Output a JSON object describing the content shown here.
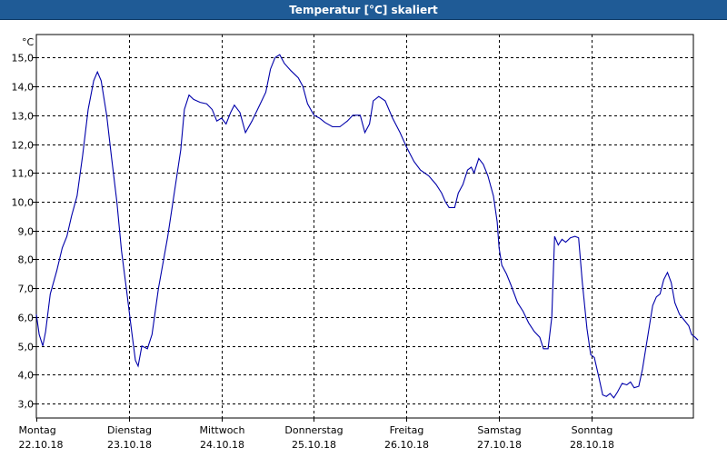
{
  "window": {
    "title": "Temperatur [°C] skaliert"
  },
  "chart_data": {
    "type": "line",
    "title": "Temperatur [°C] skaliert",
    "y_unit": "°C",
    "ylim": [
      2.5,
      15.8
    ],
    "yticks": [
      3.0,
      4.0,
      5.0,
      6.0,
      7.0,
      8.0,
      9.0,
      10.0,
      11.0,
      12.0,
      13.0,
      14.0,
      15.0
    ],
    "ytick_labels": [
      "3,0",
      "4,0",
      "5,0",
      "6,0",
      "7,0",
      "8,0",
      "9,0",
      "10,0",
      "11,0",
      "12,0",
      "13,0",
      "14,0",
      "15,0"
    ],
    "x_unit": "day",
    "xlim": [
      0,
      7.1
    ],
    "xticks": [
      {
        "x": 0,
        "day": "Montag",
        "date": "22.10.18"
      },
      {
        "x": 1,
        "day": "Dienstag",
        "date": "23.10.18"
      },
      {
        "x": 2,
        "day": "Mittwoch",
        "date": "24.10.18"
      },
      {
        "x": 3,
        "day": "Donnerstag",
        "date": "25.10.18"
      },
      {
        "x": 4,
        "day": "Freitag",
        "date": "26.10.18"
      },
      {
        "x": 5,
        "day": "Samstag",
        "date": "27.10.18"
      },
      {
        "x": 6,
        "day": "Sonntag",
        "date": "28.10.18"
      }
    ],
    "grid": true,
    "line_color": "#0000aa",
    "series": [
      {
        "points": [
          [
            0.0,
            6.1
          ],
          [
            0.03,
            5.4
          ],
          [
            0.07,
            5.0
          ],
          [
            0.1,
            5.5
          ],
          [
            0.15,
            6.8
          ],
          [
            0.22,
            7.6
          ],
          [
            0.28,
            8.4
          ],
          [
            0.33,
            8.8
          ],
          [
            0.38,
            9.5
          ],
          [
            0.44,
            10.2
          ],
          [
            0.5,
            11.6
          ],
          [
            0.56,
            13.2
          ],
          [
            0.62,
            14.2
          ],
          [
            0.66,
            14.5
          ],
          [
            0.7,
            14.2
          ],
          [
            0.76,
            13.0
          ],
          [
            0.81,
            11.6
          ],
          [
            0.87,
            10.0
          ],
          [
            0.92,
            8.3
          ],
          [
            0.98,
            6.8
          ],
          [
            1.03,
            5.5
          ],
          [
            1.07,
            4.5
          ],
          [
            1.1,
            4.3
          ],
          [
            1.14,
            5.0
          ],
          [
            1.2,
            4.9
          ],
          [
            1.25,
            5.4
          ],
          [
            1.32,
            7.0
          ],
          [
            1.42,
            8.8
          ],
          [
            1.5,
            10.5
          ],
          [
            1.56,
            11.8
          ],
          [
            1.6,
            13.2
          ],
          [
            1.65,
            13.7
          ],
          [
            1.7,
            13.55
          ],
          [
            1.77,
            13.45
          ],
          [
            1.84,
            13.4
          ],
          [
            1.9,
            13.2
          ],
          [
            1.95,
            12.8
          ],
          [
            2.0,
            12.9
          ],
          [
            2.05,
            12.7
          ],
          [
            2.1,
            13.1
          ],
          [
            2.14,
            13.35
          ],
          [
            2.2,
            13.1
          ],
          [
            2.26,
            12.4
          ],
          [
            2.33,
            12.8
          ],
          [
            2.42,
            13.4
          ],
          [
            2.48,
            13.8
          ],
          [
            2.53,
            14.6
          ],
          [
            2.58,
            15.0
          ],
          [
            2.63,
            15.1
          ],
          [
            2.68,
            14.8
          ],
          [
            2.75,
            14.55
          ],
          [
            2.83,
            14.3
          ],
          [
            2.88,
            14.0
          ],
          [
            2.93,
            13.4
          ],
          [
            3.0,
            13.0
          ],
          [
            3.06,
            12.9
          ],
          [
            3.12,
            12.75
          ],
          [
            3.2,
            12.6
          ],
          [
            3.28,
            12.6
          ],
          [
            3.36,
            12.8
          ],
          [
            3.42,
            13.0
          ],
          [
            3.5,
            13.0
          ],
          [
            3.55,
            12.4
          ],
          [
            3.6,
            12.7
          ],
          [
            3.64,
            13.5
          ],
          [
            3.7,
            13.65
          ],
          [
            3.77,
            13.5
          ],
          [
            3.85,
            12.9
          ],
          [
            3.93,
            12.4
          ],
          [
            4.0,
            11.9
          ],
          [
            4.08,
            11.4
          ],
          [
            4.15,
            11.1
          ],
          [
            4.24,
            10.9
          ],
          [
            4.32,
            10.6
          ],
          [
            4.38,
            10.3
          ],
          [
            4.42,
            10.0
          ],
          [
            4.46,
            9.8
          ],
          [
            4.52,
            9.8
          ],
          [
            4.56,
            10.3
          ],
          [
            4.61,
            10.6
          ],
          [
            4.66,
            11.1
          ],
          [
            4.7,
            11.2
          ],
          [
            4.73,
            11.0
          ],
          [
            4.78,
            11.5
          ],
          [
            4.83,
            11.3
          ],
          [
            4.88,
            10.9
          ],
          [
            4.94,
            10.2
          ],
          [
            4.98,
            9.3
          ],
          [
            5.0,
            8.4
          ],
          [
            5.03,
            7.8
          ],
          [
            5.08,
            7.5
          ],
          [
            5.13,
            7.1
          ],
          [
            5.2,
            6.5
          ],
          [
            5.26,
            6.2
          ],
          [
            5.32,
            5.8
          ],
          [
            5.38,
            5.5
          ],
          [
            5.44,
            5.3
          ],
          [
            5.48,
            4.9
          ],
          [
            5.53,
            4.9
          ],
          [
            5.57,
            6.0
          ],
          [
            5.6,
            8.8
          ],
          [
            5.64,
            8.5
          ],
          [
            5.68,
            8.7
          ],
          [
            5.72,
            8.6
          ],
          [
            5.77,
            8.75
          ],
          [
            5.82,
            8.8
          ],
          [
            5.86,
            8.75
          ],
          [
            5.9,
            7.2
          ],
          [
            5.95,
            5.6
          ],
          [
            5.99,
            4.7
          ],
          [
            6.03,
            4.6
          ],
          [
            6.08,
            3.9
          ],
          [
            6.12,
            3.3
          ],
          [
            6.16,
            3.25
          ],
          [
            6.2,
            3.35
          ],
          [
            6.24,
            3.2
          ],
          [
            6.28,
            3.4
          ],
          [
            6.33,
            3.7
          ],
          [
            6.38,
            3.65
          ],
          [
            6.42,
            3.75
          ],
          [
            6.46,
            3.55
          ],
          [
            6.51,
            3.6
          ],
          [
            6.55,
            4.2
          ],
          [
            6.6,
            5.2
          ],
          [
            6.66,
            6.4
          ],
          [
            6.7,
            6.7
          ],
          [
            6.74,
            6.8
          ],
          [
            6.78,
            7.3
          ],
          [
            6.82,
            7.55
          ],
          [
            6.86,
            7.2
          ],
          [
            6.9,
            6.5
          ],
          [
            6.95,
            6.1
          ],
          [
            7.0,
            5.9
          ],
          [
            7.05,
            5.7
          ],
          [
            7.08,
            5.4
          ],
          [
            7.12,
            5.3
          ],
          [
            7.15,
            5.2
          ]
        ]
      }
    ]
  }
}
